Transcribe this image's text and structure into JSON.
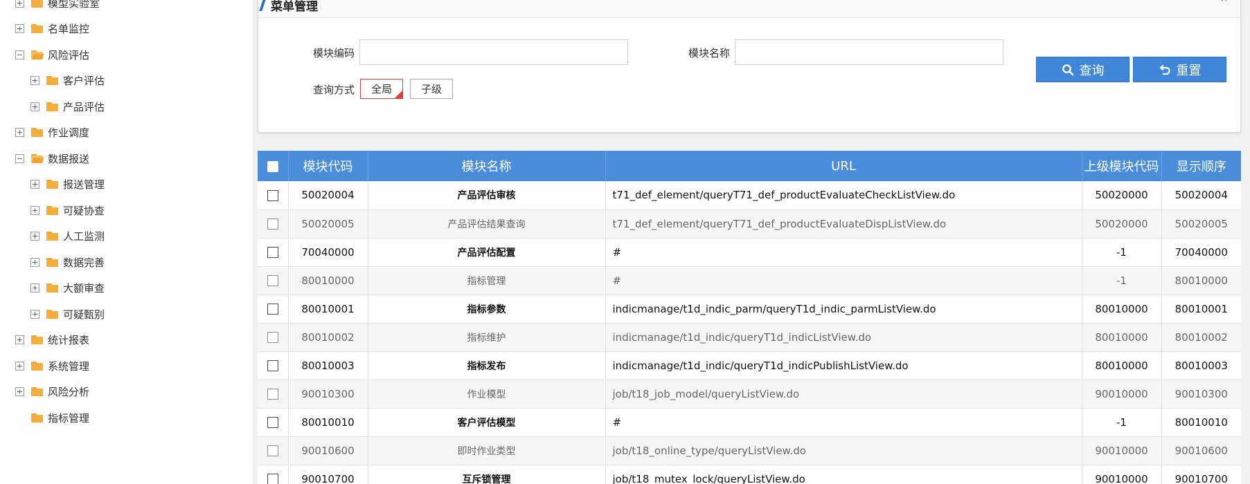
{
  "sidebar": {
    "items": [
      {
        "label": "模型实验室",
        "toggle": "plus",
        "folder": "closed",
        "level": 0
      },
      {
        "label": "名单监控",
        "toggle": "plus",
        "folder": "closed",
        "level": 0
      },
      {
        "label": "风险评估",
        "toggle": "minus",
        "folder": "open",
        "level": 0
      },
      {
        "label": "客户评估",
        "toggle": "plus",
        "folder": "closed",
        "level": 1
      },
      {
        "label": "产品评估",
        "toggle": "plus",
        "folder": "closed",
        "level": 1
      },
      {
        "label": "作业调度",
        "toggle": "plus",
        "folder": "closed",
        "level": 0
      },
      {
        "label": "数据报送",
        "toggle": "minus",
        "folder": "open",
        "level": 0
      },
      {
        "label": "报送管理",
        "toggle": "plus",
        "folder": "closed",
        "level": 1
      },
      {
        "label": "可疑协查",
        "toggle": "plus",
        "folder": "closed",
        "level": 1
      },
      {
        "label": "人工监测",
        "toggle": "plus",
        "folder": "closed",
        "level": 1
      },
      {
        "label": "数据完善",
        "toggle": "plus",
        "folder": "closed",
        "level": 1
      },
      {
        "label": "大额审查",
        "toggle": "plus",
        "folder": "closed",
        "level": 1
      },
      {
        "label": "可疑甄别",
        "toggle": "plus",
        "folder": "closed",
        "level": 1
      },
      {
        "label": "统计报表",
        "toggle": "plus",
        "folder": "closed",
        "level": 0
      },
      {
        "label": "系统管理",
        "toggle": "plus",
        "folder": "closed",
        "level": 0
      },
      {
        "label": "风险分析",
        "toggle": "plus",
        "folder": "closed",
        "level": 0
      },
      {
        "label": "指标管理",
        "toggle": "none",
        "folder": "closed",
        "level": 0
      }
    ]
  },
  "panel": {
    "title": "菜单管理",
    "collapse_glyph": "^",
    "module_code_label": "模块编码",
    "module_code_value": "",
    "module_name_label": "模块名称",
    "module_name_value": "",
    "query_mode_label": "查询方式",
    "mode_global": "全局",
    "mode_child": "子级",
    "search_label": "查询",
    "reset_label": "重置"
  },
  "table": {
    "headers": [
      "模块代码",
      "模块名称",
      "URL",
      "上级模块代码",
      "显示顺序"
    ],
    "rows": [
      {
        "code": "50020004",
        "name": "产品评估审核",
        "url": "t71_def_element/queryT71_def_productEvaluateCheckListView.do",
        "parent": "50020000",
        "order": "50020004"
      },
      {
        "code": "50020005",
        "name": "产品评估结果查询",
        "url": "t71_def_element/queryT71_def_productEvaluateDispListView.do",
        "parent": "50020000",
        "order": "50020005"
      },
      {
        "code": "70040000",
        "name": "产品评估配置",
        "url": "#",
        "parent": "-1",
        "order": "70040000"
      },
      {
        "code": "80010000",
        "name": "指标管理",
        "url": "#",
        "parent": "-1",
        "order": "80010000"
      },
      {
        "code": "80010001",
        "name": "指标参数",
        "url": "indicmanage/t1d_indic_parm/queryT1d_indic_parmListView.do",
        "parent": "80010000",
        "order": "80010001"
      },
      {
        "code": "80010002",
        "name": "指标维护",
        "url": "indicmanage/t1d_indic/queryT1d_indicListView.do",
        "parent": "80010000",
        "order": "80010002"
      },
      {
        "code": "80010003",
        "name": "指标发布",
        "url": "indicmanage/t1d_indic/queryT1d_indicPublishListView.do",
        "parent": "80010000",
        "order": "80010003"
      },
      {
        "code": "90010300",
        "name": "作业模型",
        "url": "job/t18_job_model/queryListView.do",
        "parent": "90010000",
        "order": "90010300"
      },
      {
        "code": "80010010",
        "name": "客户评估模型",
        "url": "#",
        "parent": "-1",
        "order": "80010010"
      },
      {
        "code": "90010600",
        "name": "即时作业类型",
        "url": "job/t18_online_type/queryListView.do",
        "parent": "90010000",
        "order": "90010600"
      },
      {
        "code": "90010700",
        "name": "互斥锁管理",
        "url": "job/t18_mutex_lock/queryListView.do",
        "parent": "90010000",
        "order": "90010700"
      }
    ]
  },
  "colors": {
    "accent": "#3f86d8",
    "header_bg": "#4a8ddb",
    "active_border": "#e23b3b",
    "folder": "#f5ad3b"
  }
}
